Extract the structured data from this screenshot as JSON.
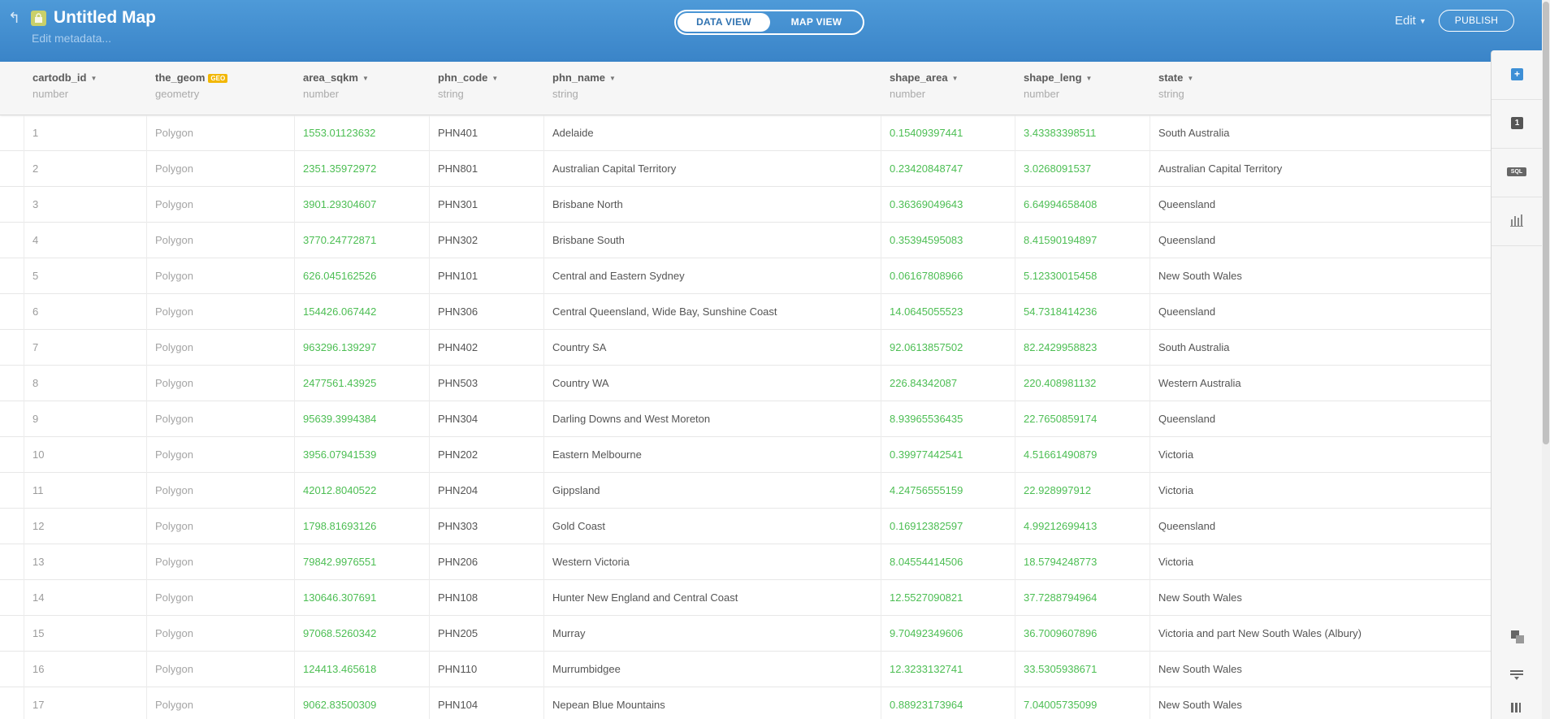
{
  "header": {
    "title": "Untitled Map",
    "metadata_link": "Edit metadata...",
    "view_toggle": {
      "data_view": "DATA VIEW",
      "map_view": "MAP VIEW",
      "active": "data_view"
    },
    "edit_menu": "Edit",
    "publish": "PUBLISH"
  },
  "columns": [
    {
      "name": "cartodb_id",
      "type": "number"
    },
    {
      "name": "the_geom",
      "type": "geometry",
      "badge": "GEO"
    },
    {
      "name": "area_sqkm",
      "type": "number"
    },
    {
      "name": "phn_code",
      "type": "string"
    },
    {
      "name": "phn_name",
      "type": "string"
    },
    {
      "name": "shape_area",
      "type": "number"
    },
    {
      "name": "shape_leng",
      "type": "number"
    },
    {
      "name": "state",
      "type": "string"
    }
  ],
  "rows": [
    [
      "1",
      "Polygon",
      "1553.01123632",
      "PHN401",
      "Adelaide",
      "0.15409397441",
      "3.43383398511",
      "South Australia"
    ],
    [
      "2",
      "Polygon",
      "2351.35972972",
      "PHN801",
      "Australian Capital Territory",
      "0.23420848747",
      "3.0268091537",
      "Australian Capital Territory"
    ],
    [
      "3",
      "Polygon",
      "3901.29304607",
      "PHN301",
      "Brisbane North",
      "0.36369049643",
      "6.64994658408",
      "Queensland"
    ],
    [
      "4",
      "Polygon",
      "3770.24772871",
      "PHN302",
      "Brisbane South",
      "0.35394595083",
      "8.41590194897",
      "Queensland"
    ],
    [
      "5",
      "Polygon",
      "626.045162526",
      "PHN101",
      "Central and Eastern Sydney",
      "0.06167808966",
      "5.12330015458",
      "New South Wales"
    ],
    [
      "6",
      "Polygon",
      "154426.067442",
      "PHN306",
      "Central Queensland, Wide Bay, Sunshine Coast",
      "14.0645055523",
      "54.7318414236",
      "Queensland"
    ],
    [
      "7",
      "Polygon",
      "963296.139297",
      "PHN402",
      "Country SA",
      "92.0613857502",
      "82.2429958823",
      "South Australia"
    ],
    [
      "8",
      "Polygon",
      "2477561.43925",
      "PHN503",
      "Country WA",
      "226.84342087",
      "220.408981132",
      "Western Australia"
    ],
    [
      "9",
      "Polygon",
      "95639.3994384",
      "PHN304",
      "Darling Downs and West Moreton",
      "8.93965536435",
      "22.7650859174",
      "Queensland"
    ],
    [
      "10",
      "Polygon",
      "3956.07941539",
      "PHN202",
      "Eastern Melbourne",
      "0.39977442541",
      "4.51661490879",
      "Victoria"
    ],
    [
      "11",
      "Polygon",
      "42012.8040522",
      "PHN204",
      "Gippsland",
      "4.24756555159",
      "22.928997912",
      "Victoria"
    ],
    [
      "12",
      "Polygon",
      "1798.81693126",
      "PHN303",
      "Gold Coast",
      "0.16912382597",
      "4.99212699413",
      "Queensland"
    ],
    [
      "13",
      "Polygon",
      "79842.9976551",
      "PHN206",
      "Western Victoria",
      "8.04554414506",
      "18.5794248773",
      "Victoria"
    ],
    [
      "14",
      "Polygon",
      "130646.307691",
      "PHN108",
      "Hunter New England and Central Coast",
      "12.5527090821",
      "37.7288794964",
      "New South Wales"
    ],
    [
      "15",
      "Polygon",
      "97068.5260342",
      "PHN205",
      "Murray",
      "9.70492349606",
      "36.7009607896",
      "Victoria and part New South Wales (Albury)"
    ],
    [
      "16",
      "Polygon",
      "124413.465618",
      "PHN110",
      "Murrumbidgee",
      "12.3233132741",
      "33.5305938671",
      "New South Wales"
    ],
    [
      "17",
      "Polygon",
      "9062.83500309",
      "PHN104",
      "Nepean Blue Mountains",
      "0.88923173964",
      "7.04005735099",
      "New South Wales"
    ]
  ],
  "right_panel": {
    "items": [
      {
        "icon": "add-layer-icon"
      },
      {
        "icon": "layer-number-icon",
        "label": "1"
      },
      {
        "icon": "sql-icon",
        "label": "SQL"
      },
      {
        "icon": "chart-icon"
      },
      {
        "icon": "merge-tables-icon"
      },
      {
        "icon": "filter-icon"
      },
      {
        "icon": "legend-icon"
      }
    ]
  },
  "colors": {
    "header": "#3f8acd",
    "numeric": "#4cbe53",
    "geo_badge": "#f2b705"
  }
}
